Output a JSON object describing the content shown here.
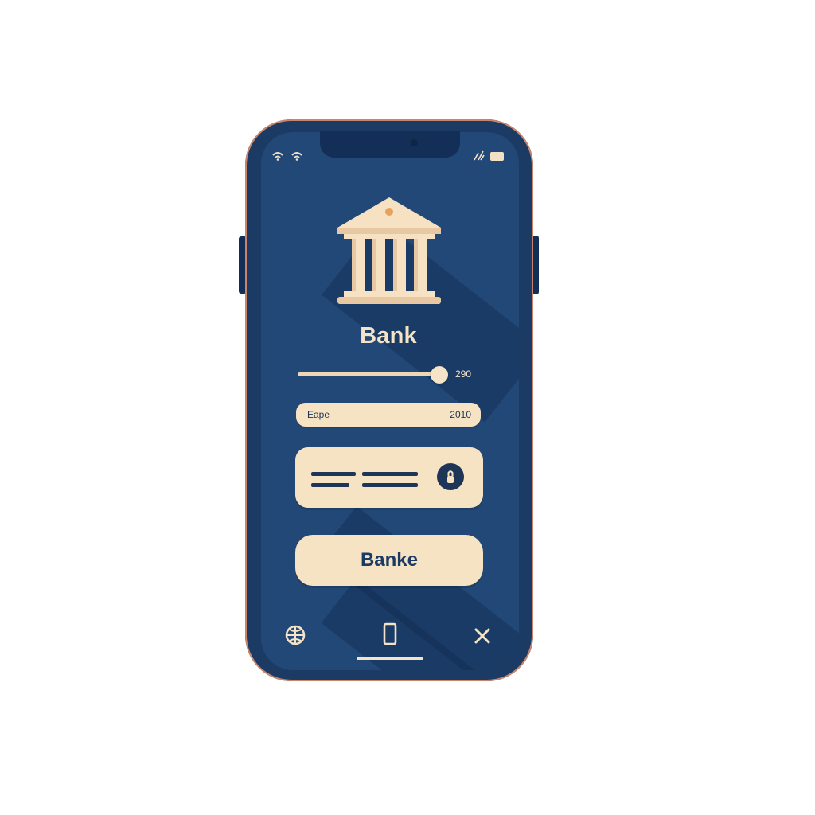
{
  "app": {
    "title": "Bank"
  },
  "status_bar": {
    "left_icons": [
      "wifi-icon",
      "signal-icon"
    ],
    "right_icons": [
      "signal-bars-icon",
      "battery-icon"
    ]
  },
  "slider": {
    "value_label": "290",
    "fill_fraction": 0.94
  },
  "field": {
    "label": "Eape",
    "value": "2010"
  },
  "card": {
    "icon": "lock-icon"
  },
  "primary_button": {
    "label": "Banke"
  },
  "bottom_nav": {
    "items": [
      "globe-icon",
      "phone-icon",
      "close-icon"
    ]
  },
  "colors": {
    "phone_body": "#1b3a64",
    "screen": "#224877",
    "accent_cream": "#f6e3c4",
    "text_dark": "#1e3558"
  }
}
